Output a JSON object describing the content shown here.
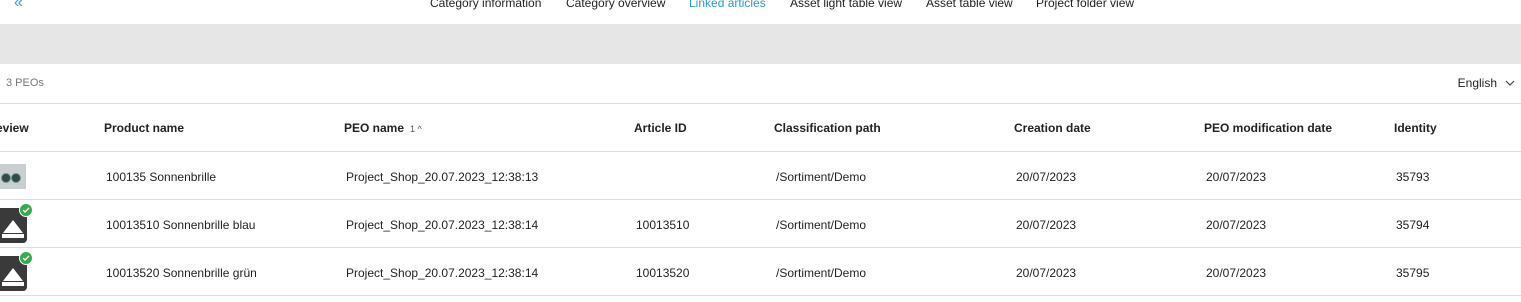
{
  "nav": {
    "collapse_icon": "«",
    "tabs": [
      {
        "label": "Category information",
        "active": false
      },
      {
        "label": "Category overview",
        "active": false
      },
      {
        "label": "Linked articles",
        "active": true
      },
      {
        "label": "Asset light table view",
        "active": false
      },
      {
        "label": "Asset table view",
        "active": false
      },
      {
        "label": "Project folder view",
        "active": false
      }
    ]
  },
  "toolbar": {
    "count": "3 PEOs",
    "language": "English"
  },
  "table": {
    "columns": {
      "preview": "eview",
      "product_name": "Product name",
      "peo_name": "PEO name",
      "peo_sort": "1 ^",
      "article_id": "Article ID",
      "classification_path": "Classification path",
      "creation_date": "Creation date",
      "peo_modification_date": "PEO modification date",
      "identity": "Identity"
    },
    "rows": [
      {
        "preview": "sunglasses-photo",
        "product_name": "100135 Sonnenbrille",
        "peo_name": "Project_Shop_20.07.2023_12:38:13",
        "article_id": "",
        "classification_path": "/Sortiment/Demo",
        "creation_date": "20/07/2023",
        "peo_modification_date": "20/07/2023",
        "identity": "35793"
      },
      {
        "preview": "image-placeholder-checked",
        "product_name": "10013510 Sonnenbrille blau",
        "peo_name": "Project_Shop_20.07.2023_12:38:14",
        "article_id": "10013510",
        "classification_path": "/Sortiment/Demo",
        "creation_date": "20/07/2023",
        "peo_modification_date": "20/07/2023",
        "identity": "35794"
      },
      {
        "preview": "image-placeholder-checked",
        "product_name": "10013520 Sonnenbrille grün",
        "peo_name": "Project_Shop_20.07.2023_12:38:14",
        "article_id": "10013520",
        "classification_path": "/Sortiment/Demo",
        "creation_date": "20/07/2023",
        "peo_modification_date": "20/07/2023",
        "identity": "35795"
      }
    ]
  },
  "colors": {
    "accent": "#2b9ad0",
    "check_badge": "#2fae4a",
    "bar_grey": "#e6e6e6"
  }
}
